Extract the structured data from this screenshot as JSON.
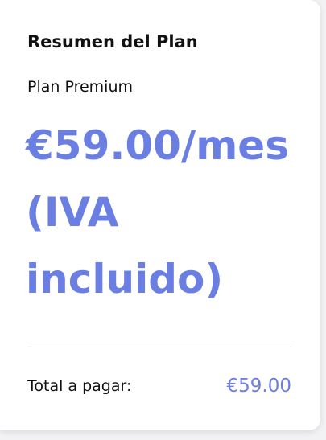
{
  "summary": {
    "title": "Resumen del Plan",
    "plan_name": "Plan Premium",
    "price_text": "€59.00/mes (IVA incluido)",
    "total_label": "Total a pagar:",
    "total_value": "€59.00"
  },
  "colors": {
    "accent": "#6b7fe3",
    "text": "#111111",
    "background": "#ffffff",
    "divider": "#e6e6e6"
  }
}
